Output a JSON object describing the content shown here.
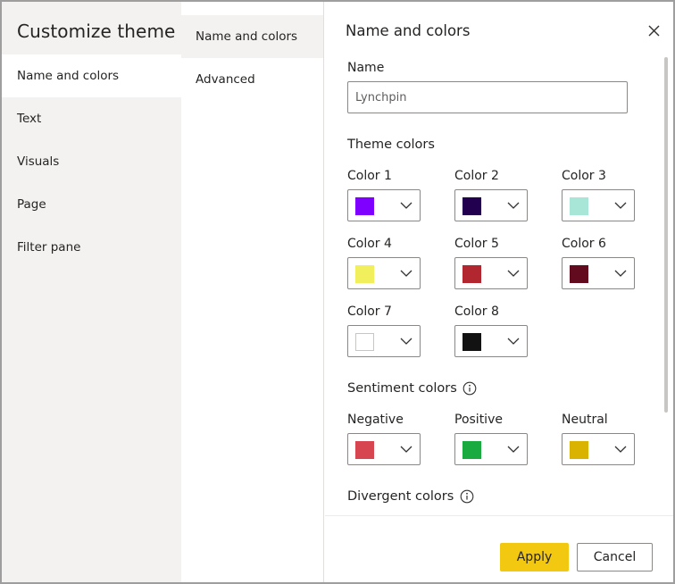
{
  "dialog": {
    "title": "Customize theme",
    "close_icon": "close-icon"
  },
  "nav": {
    "items": [
      {
        "label": "Name and colors",
        "selected": true
      },
      {
        "label": "Text",
        "selected": false
      },
      {
        "label": "Visuals",
        "selected": false
      },
      {
        "label": "Page",
        "selected": false
      },
      {
        "label": "Filter pane",
        "selected": false
      }
    ]
  },
  "subnav": {
    "items": [
      {
        "label": "Name and colors",
        "selected": true
      },
      {
        "label": "Advanced",
        "selected": false
      }
    ]
  },
  "main": {
    "title": "Name and colors",
    "name_label": "Name",
    "name_value": "Lynchpin",
    "theme_colors_heading": "Theme colors",
    "theme_colors": [
      {
        "label": "Color 1",
        "color": "#7f00ff"
      },
      {
        "label": "Color 2",
        "color": "#22004f"
      },
      {
        "label": "Color 3",
        "color": "#a8e6d8"
      },
      {
        "label": "Color 4",
        "color": "#f2ef5c"
      },
      {
        "label": "Color 5",
        "color": "#b2272f"
      },
      {
        "label": "Color 6",
        "color": "#620b1f"
      },
      {
        "label": "Color 7",
        "color": "#ffffff"
      },
      {
        "label": "Color 8",
        "color": "#121212"
      }
    ],
    "sentiment_heading": "Sentiment colors",
    "sentiment_colors": [
      {
        "label": "Negative",
        "color": "#d64550"
      },
      {
        "label": "Positive",
        "color": "#1aab40"
      },
      {
        "label": "Neutral",
        "color": "#d9b300"
      }
    ],
    "divergent_heading": "Divergent colors"
  },
  "footer": {
    "apply_label": "Apply",
    "cancel_label": "Cancel"
  },
  "colors": {
    "accent": "#f2c811",
    "nav_bg": "#f3f2f1"
  }
}
